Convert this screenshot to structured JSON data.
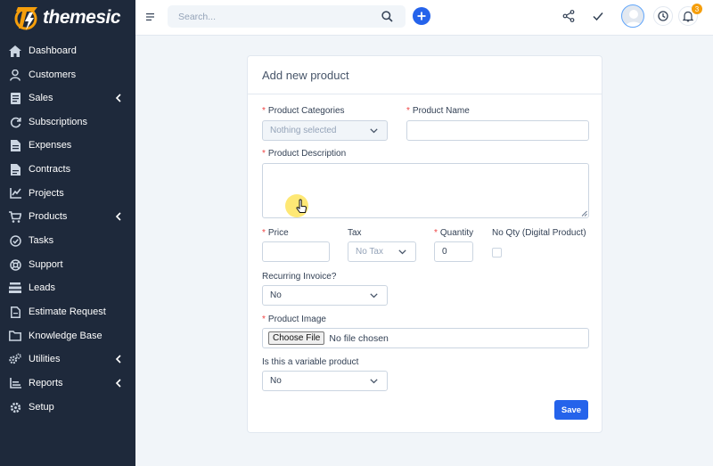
{
  "brand": {
    "name": "themesic",
    "accent": "#f59e0b"
  },
  "header": {
    "search_placeholder": "Search...",
    "notification_count": "3"
  },
  "sidebar": {
    "items": [
      {
        "label": "Dashboard",
        "icon": "home-icon",
        "has_submenu": false
      },
      {
        "label": "Customers",
        "icon": "user-icon",
        "has_submenu": false
      },
      {
        "label": "Sales",
        "icon": "receipt-icon",
        "has_submenu": true
      },
      {
        "label": "Subscriptions",
        "icon": "refresh-icon",
        "has_submenu": false
      },
      {
        "label": "Expenses",
        "icon": "file-icon",
        "has_submenu": false
      },
      {
        "label": "Contracts",
        "icon": "document-icon",
        "has_submenu": false
      },
      {
        "label": "Projects",
        "icon": "chart-icon",
        "has_submenu": false
      },
      {
        "label": "Products",
        "icon": "cart-icon",
        "has_submenu": true
      },
      {
        "label": "Tasks",
        "icon": "check-circle-icon",
        "has_submenu": false
      },
      {
        "label": "Support",
        "icon": "lifebuoy-icon",
        "has_submenu": false
      },
      {
        "label": "Leads",
        "icon": "stack-icon",
        "has_submenu": false
      },
      {
        "label": "Estimate Request",
        "icon": "file-text-icon",
        "has_submenu": false
      },
      {
        "label": "Knowledge Base",
        "icon": "folder-icon",
        "has_submenu": false
      },
      {
        "label": "Utilities",
        "icon": "cogs-icon",
        "has_submenu": true
      },
      {
        "label": "Reports",
        "icon": "bar-chart-icon",
        "has_submenu": true
      },
      {
        "label": "Setup",
        "icon": "gear-icon",
        "has_submenu": false
      }
    ]
  },
  "form": {
    "title": "Add new product",
    "required_mark": "*",
    "product_categories": {
      "label": "Product Categories",
      "value": "Nothing selected"
    },
    "product_name": {
      "label": "Product Name",
      "value": ""
    },
    "product_description": {
      "label": "Product Description",
      "value": ""
    },
    "price": {
      "label": "Price",
      "value": ""
    },
    "tax": {
      "label": "Tax",
      "value": "No Tax"
    },
    "quantity": {
      "label": "Quantity",
      "value": "0"
    },
    "no_qty": {
      "label": "No Qty (Digital Product)",
      "checked": false
    },
    "recurring_invoice": {
      "label": "Recurring Invoice?",
      "value": "No"
    },
    "product_image": {
      "label": "Product Image",
      "button": "Choose File",
      "status": "No file chosen"
    },
    "variable_product": {
      "label": "Is this a variable product",
      "value": "No"
    },
    "save_label": "Save"
  },
  "colors": {
    "sidebar_bg": "#1e293b",
    "primary": "#2563eb",
    "required": "#ef4444",
    "page_bg": "#f1f5f9"
  }
}
